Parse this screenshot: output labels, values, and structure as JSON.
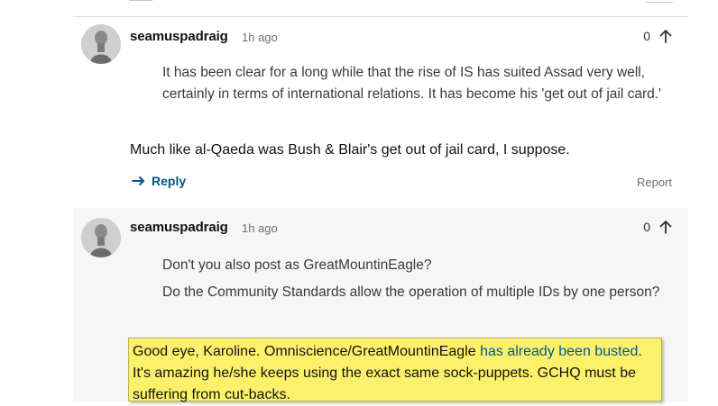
{
  "comments": [
    {
      "username": "seamuspadraig",
      "time": "1h ago",
      "recommend_count": "0",
      "quote": "It has been clear for a long while that the rise of IS has suited Assad very well, certainly in terms of international relations. It has become his 'get out of jail card.'",
      "body": "Much like al-Qaeda was Bush & Blair's get out of jail card, I suppose.",
      "reply_label": "Reply",
      "report_label": "Report"
    },
    {
      "username": "seamuspadraig",
      "time": "1h ago",
      "recommend_count": "0",
      "quote_lines": [
        "Don't you also post as GreatMountinEagle?",
        "Do the Community Standards allow the operation of multiple IDs by one person?"
      ],
      "body_pre": "Good eye, Karoline. Omniscience/GreatMountinEagle ",
      "body_link": "has already been busted",
      "body_post": ". It's amazing he/she keeps using the exact same sock-puppets. GCHQ must be suffering from cut-backs."
    }
  ],
  "colors": {
    "link": "#005689",
    "highlight": "#fdf16b",
    "alt_background": "#f6f6f6"
  },
  "icons": {
    "recommend": "arrow-up-icon",
    "reply": "reply-arrow-icon"
  }
}
